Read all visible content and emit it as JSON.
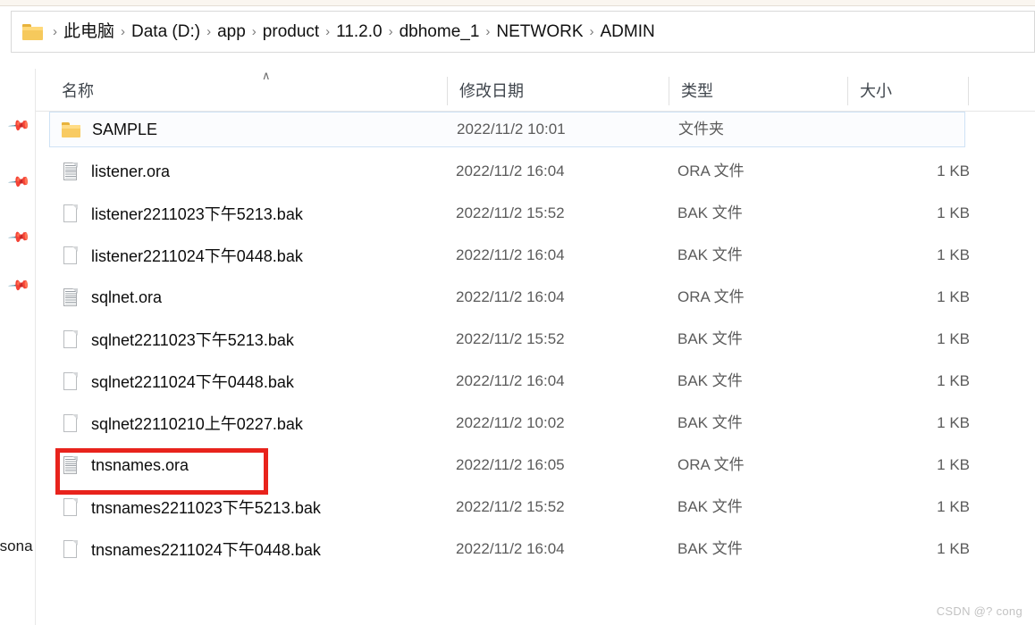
{
  "window": {
    "app": "Windows File Explorer"
  },
  "breadcrumb": {
    "folder_icon": "folder-icon",
    "separator": "›",
    "items": [
      "此电脑",
      "Data (D:)",
      "app",
      "product",
      "11.2.0",
      "dbhome_1",
      "NETWORK",
      "ADMIN"
    ]
  },
  "sidebar": {
    "pins": [
      "pin-icon",
      "pin-icon",
      "pin-icon",
      "pin-icon"
    ],
    "partial_label": "rsona"
  },
  "columns": {
    "sort_caret": "∧",
    "headers": [
      "名称",
      "修改日期",
      "类型",
      "大小"
    ]
  },
  "files": [
    {
      "name": "SAMPLE",
      "date": "2022/11/2 10:01",
      "type": "文件夹",
      "size": "",
      "icon": "folder-icon",
      "selected": true
    },
    {
      "name": "listener.ora",
      "date": "2022/11/2 16:04",
      "type": "ORA 文件",
      "size": "1 KB",
      "icon": "document-icon",
      "selected": false
    },
    {
      "name": "listener2211023下午5213.bak",
      "date": "2022/11/2 15:52",
      "type": "BAK 文件",
      "size": "1 KB",
      "icon": "page-icon",
      "selected": false
    },
    {
      "name": "listener2211024下午0448.bak",
      "date": "2022/11/2 16:04",
      "type": "BAK 文件",
      "size": "1 KB",
      "icon": "page-icon",
      "selected": false
    },
    {
      "name": "sqlnet.ora",
      "date": "2022/11/2 16:04",
      "type": "ORA 文件",
      "size": "1 KB",
      "icon": "document-icon",
      "selected": false
    },
    {
      "name": "sqlnet2211023下午5213.bak",
      "date": "2022/11/2 15:52",
      "type": "BAK 文件",
      "size": "1 KB",
      "icon": "page-icon",
      "selected": false
    },
    {
      "name": "sqlnet2211024下午0448.bak",
      "date": "2022/11/2 16:04",
      "type": "BAK 文件",
      "size": "1 KB",
      "icon": "page-icon",
      "selected": false
    },
    {
      "name": "sqlnet22110210上午0227.bak",
      "date": "2022/11/2 10:02",
      "type": "BAK 文件",
      "size": "1 KB",
      "icon": "page-icon",
      "selected": false
    },
    {
      "name": "tnsnames.ora",
      "date": "2022/11/2 16:05",
      "type": "ORA 文件",
      "size": "1 KB",
      "icon": "document-icon",
      "selected": false
    },
    {
      "name": "tnsnames2211023下午5213.bak",
      "date": "2022/11/2 15:52",
      "type": "BAK 文件",
      "size": "1 KB",
      "icon": "page-icon",
      "selected": false
    },
    {
      "name": "tnsnames2211024下午0448.bak",
      "date": "2022/11/2 16:04",
      "type": "BAK 文件",
      "size": "1 KB",
      "icon": "page-icon",
      "selected": false
    }
  ],
  "annotation": {
    "target_row_index": 8,
    "color": "#e8231c"
  },
  "watermark": {
    "text": "CSDN @? cong"
  }
}
